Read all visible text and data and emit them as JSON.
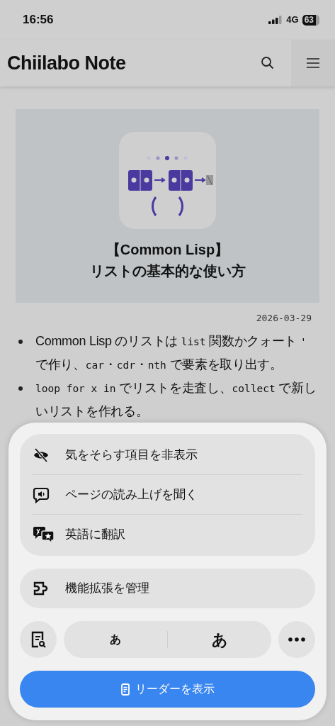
{
  "status_bar": {
    "time": "16:56",
    "network": "4G",
    "battery": "63"
  },
  "header": {
    "site_title": "Chiilabo Note"
  },
  "hero": {
    "title_lines": [
      "【Common Lisp】",
      "リストの基本的な使い方"
    ]
  },
  "article": {
    "date": "2026-03-29",
    "bullets": [
      [
        {
          "text": "Common Lisp のリストは ",
          "code": false
        },
        {
          "text": "list",
          "code": true
        },
        {
          "text": " 関数かクォート ",
          "code": false
        },
        {
          "text": "'",
          "code": true
        },
        {
          "text": " で作り、",
          "code": false
        },
        {
          "text": "car",
          "code": true
        },
        {
          "text": "・",
          "code": false
        },
        {
          "text": "cdr",
          "code": true
        },
        {
          "text": "・",
          "code": false
        },
        {
          "text": "nth",
          "code": true
        },
        {
          "text": " で要素を取り出す。",
          "code": false
        }
      ],
      [
        {
          "text": "loop for x in",
          "code": true
        },
        {
          "text": " でリストを走査し、",
          "code": false
        },
        {
          "text": "collect",
          "code": true
        },
        {
          "text": " で新しいリストを作れる。",
          "code": false
        }
      ]
    ]
  },
  "sheet": {
    "menu_items": [
      {
        "label": "気をそらす項目を非表示",
        "kind": "hide"
      },
      {
        "label": "ページの読み上げを聞く",
        "kind": "listen"
      },
      {
        "label": "英語に翻訳",
        "kind": "translate"
      }
    ],
    "extensions": {
      "label": "機能拡張を管理"
    },
    "text_size": {
      "smaller": "あ",
      "larger": "あ"
    },
    "reader_button": {
      "label": "リーダーを表示"
    }
  }
}
